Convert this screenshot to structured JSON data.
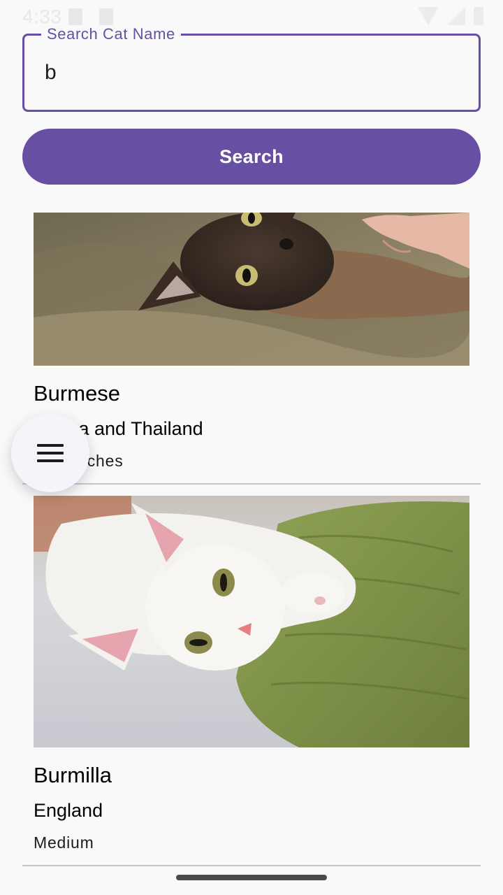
{
  "status_bar": {
    "time": "4:33"
  },
  "search": {
    "label": "Search Cat Name",
    "value": "b",
    "button_label": "Search"
  },
  "cats": [
    {
      "name": "Burmese",
      "origin": "Burma and Thailand",
      "size": "6 - 8 inches",
      "image": "burmese-cat-photo"
    },
    {
      "name": "Burmilla",
      "origin": "England",
      "size": "Medium",
      "image": "burmilla-cat-photo"
    }
  ],
  "colors": {
    "primary": "#6750a4",
    "background": "#f9f9f9",
    "divider": "#cac4d0"
  },
  "fab": {
    "icon": "menu-icon"
  }
}
